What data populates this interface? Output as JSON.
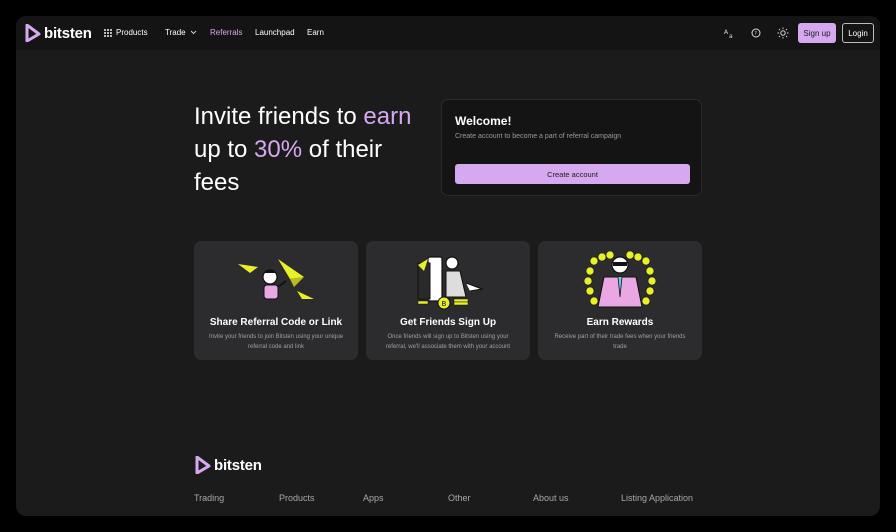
{
  "brand": {
    "name": "bitsten",
    "color": "#d6a8f0"
  },
  "nav": {
    "products": "Products",
    "trade": "Trade",
    "referrals": "Referrals",
    "launchpad": "Launchpad",
    "earn": "Earn",
    "signup": "Sign up",
    "login": "Login",
    "icons": [
      "translate-icon",
      "help-icon",
      "theme-icon"
    ]
  },
  "hero": {
    "line1a": "Invite friends to ",
    "line1b": "earn",
    "line2a": "up to ",
    "line2b": "30%",
    "line2c": " of their",
    "line3": "fees"
  },
  "welcome": {
    "title": "Welcome!",
    "subtitle": "Create account to become a part of referral campaign",
    "button": "Create account"
  },
  "cards": [
    {
      "title": "Share Referral Code or Link",
      "desc": "Invite your friends to join Bitsten using your unique referral code and link"
    },
    {
      "title": "Get Friends Sign Up",
      "desc": "Once friends will sign up to Bitsten using your referral, we'll associate them with your account"
    },
    {
      "title": "Earn Rewards",
      "desc": "Receive part of their trade fees when your friends trade"
    }
  ],
  "footer": {
    "links": [
      "Trading",
      "Products",
      "Apps",
      "Other",
      "About us",
      "Listing Application"
    ]
  }
}
